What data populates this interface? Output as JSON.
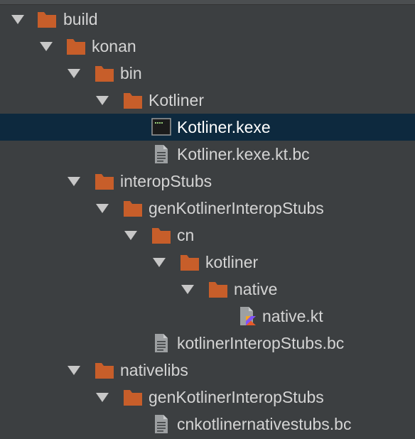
{
  "colors": {
    "background": "#3c3f41",
    "selection": "#0d293e",
    "folder": "#c75e2a",
    "text": "#d4d4d4",
    "arrow": "#c7c7c7"
  },
  "tree": [
    {
      "label": "build",
      "icon": "folder-icon",
      "expanded": true,
      "selected": false
    },
    {
      "label": "konan",
      "icon": "folder-icon",
      "expanded": true,
      "selected": false
    },
    {
      "label": "bin",
      "icon": "folder-icon",
      "expanded": true,
      "selected": false
    },
    {
      "label": "Kotliner",
      "icon": "folder-icon",
      "expanded": true,
      "selected": false
    },
    {
      "label": "Kotliner.kexe",
      "icon": "executable-icon",
      "expanded": null,
      "selected": true
    },
    {
      "label": "Kotliner.kexe.kt.bc",
      "icon": "file-icon",
      "expanded": null,
      "selected": false
    },
    {
      "label": "interopStubs",
      "icon": "folder-icon",
      "expanded": true,
      "selected": false
    },
    {
      "label": "genKotlinerInteropStubs",
      "icon": "folder-icon",
      "expanded": true,
      "selected": false
    },
    {
      "label": "cn",
      "icon": "folder-icon",
      "expanded": true,
      "selected": false
    },
    {
      "label": "kotliner",
      "icon": "folder-icon",
      "expanded": true,
      "selected": false
    },
    {
      "label": "native",
      "icon": "folder-icon",
      "expanded": true,
      "selected": false
    },
    {
      "label": "native.kt",
      "icon": "kotlin-file-icon",
      "expanded": null,
      "selected": false
    },
    {
      "label": "kotlinerInteropStubs.bc",
      "icon": "file-icon",
      "expanded": null,
      "selected": false
    },
    {
      "label": "nativelibs",
      "icon": "folder-icon",
      "expanded": true,
      "selected": false
    },
    {
      "label": "genKotlinerInteropStubs",
      "icon": "folder-icon",
      "expanded": true,
      "selected": false
    },
    {
      "label": "cnkotlinernativestubs.bc",
      "icon": "file-icon",
      "expanded": null,
      "selected": false
    }
  ]
}
